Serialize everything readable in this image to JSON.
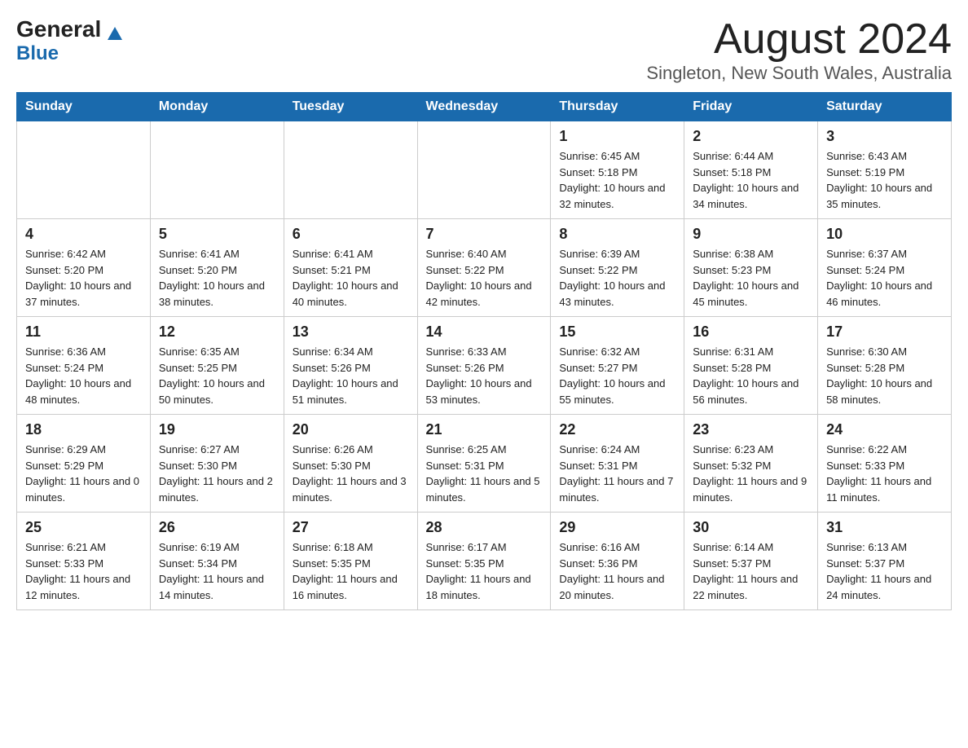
{
  "logo": {
    "general": "General",
    "blue": "Blue"
  },
  "header": {
    "month_year": "August 2024",
    "location": "Singleton, New South Wales, Australia"
  },
  "weekdays": [
    "Sunday",
    "Monday",
    "Tuesday",
    "Wednesday",
    "Thursday",
    "Friday",
    "Saturday"
  ],
  "weeks": [
    [
      {
        "day": "",
        "info": ""
      },
      {
        "day": "",
        "info": ""
      },
      {
        "day": "",
        "info": ""
      },
      {
        "day": "",
        "info": ""
      },
      {
        "day": "1",
        "info": "Sunrise: 6:45 AM\nSunset: 5:18 PM\nDaylight: 10 hours and 32 minutes."
      },
      {
        "day": "2",
        "info": "Sunrise: 6:44 AM\nSunset: 5:18 PM\nDaylight: 10 hours and 34 minutes."
      },
      {
        "day": "3",
        "info": "Sunrise: 6:43 AM\nSunset: 5:19 PM\nDaylight: 10 hours and 35 minutes."
      }
    ],
    [
      {
        "day": "4",
        "info": "Sunrise: 6:42 AM\nSunset: 5:20 PM\nDaylight: 10 hours and 37 minutes."
      },
      {
        "day": "5",
        "info": "Sunrise: 6:41 AM\nSunset: 5:20 PM\nDaylight: 10 hours and 38 minutes."
      },
      {
        "day": "6",
        "info": "Sunrise: 6:41 AM\nSunset: 5:21 PM\nDaylight: 10 hours and 40 minutes."
      },
      {
        "day": "7",
        "info": "Sunrise: 6:40 AM\nSunset: 5:22 PM\nDaylight: 10 hours and 42 minutes."
      },
      {
        "day": "8",
        "info": "Sunrise: 6:39 AM\nSunset: 5:22 PM\nDaylight: 10 hours and 43 minutes."
      },
      {
        "day": "9",
        "info": "Sunrise: 6:38 AM\nSunset: 5:23 PM\nDaylight: 10 hours and 45 minutes."
      },
      {
        "day": "10",
        "info": "Sunrise: 6:37 AM\nSunset: 5:24 PM\nDaylight: 10 hours and 46 minutes."
      }
    ],
    [
      {
        "day": "11",
        "info": "Sunrise: 6:36 AM\nSunset: 5:24 PM\nDaylight: 10 hours and 48 minutes."
      },
      {
        "day": "12",
        "info": "Sunrise: 6:35 AM\nSunset: 5:25 PM\nDaylight: 10 hours and 50 minutes."
      },
      {
        "day": "13",
        "info": "Sunrise: 6:34 AM\nSunset: 5:26 PM\nDaylight: 10 hours and 51 minutes."
      },
      {
        "day": "14",
        "info": "Sunrise: 6:33 AM\nSunset: 5:26 PM\nDaylight: 10 hours and 53 minutes."
      },
      {
        "day": "15",
        "info": "Sunrise: 6:32 AM\nSunset: 5:27 PM\nDaylight: 10 hours and 55 minutes."
      },
      {
        "day": "16",
        "info": "Sunrise: 6:31 AM\nSunset: 5:28 PM\nDaylight: 10 hours and 56 minutes."
      },
      {
        "day": "17",
        "info": "Sunrise: 6:30 AM\nSunset: 5:28 PM\nDaylight: 10 hours and 58 minutes."
      }
    ],
    [
      {
        "day": "18",
        "info": "Sunrise: 6:29 AM\nSunset: 5:29 PM\nDaylight: 11 hours and 0 minutes."
      },
      {
        "day": "19",
        "info": "Sunrise: 6:27 AM\nSunset: 5:30 PM\nDaylight: 11 hours and 2 minutes."
      },
      {
        "day": "20",
        "info": "Sunrise: 6:26 AM\nSunset: 5:30 PM\nDaylight: 11 hours and 3 minutes."
      },
      {
        "day": "21",
        "info": "Sunrise: 6:25 AM\nSunset: 5:31 PM\nDaylight: 11 hours and 5 minutes."
      },
      {
        "day": "22",
        "info": "Sunrise: 6:24 AM\nSunset: 5:31 PM\nDaylight: 11 hours and 7 minutes."
      },
      {
        "day": "23",
        "info": "Sunrise: 6:23 AM\nSunset: 5:32 PM\nDaylight: 11 hours and 9 minutes."
      },
      {
        "day": "24",
        "info": "Sunrise: 6:22 AM\nSunset: 5:33 PM\nDaylight: 11 hours and 11 minutes."
      }
    ],
    [
      {
        "day": "25",
        "info": "Sunrise: 6:21 AM\nSunset: 5:33 PM\nDaylight: 11 hours and 12 minutes."
      },
      {
        "day": "26",
        "info": "Sunrise: 6:19 AM\nSunset: 5:34 PM\nDaylight: 11 hours and 14 minutes."
      },
      {
        "day": "27",
        "info": "Sunrise: 6:18 AM\nSunset: 5:35 PM\nDaylight: 11 hours and 16 minutes."
      },
      {
        "day": "28",
        "info": "Sunrise: 6:17 AM\nSunset: 5:35 PM\nDaylight: 11 hours and 18 minutes."
      },
      {
        "day": "29",
        "info": "Sunrise: 6:16 AM\nSunset: 5:36 PM\nDaylight: 11 hours and 20 minutes."
      },
      {
        "day": "30",
        "info": "Sunrise: 6:14 AM\nSunset: 5:37 PM\nDaylight: 11 hours and 22 minutes."
      },
      {
        "day": "31",
        "info": "Sunrise: 6:13 AM\nSunset: 5:37 PM\nDaylight: 11 hours and 24 minutes."
      }
    ]
  ]
}
